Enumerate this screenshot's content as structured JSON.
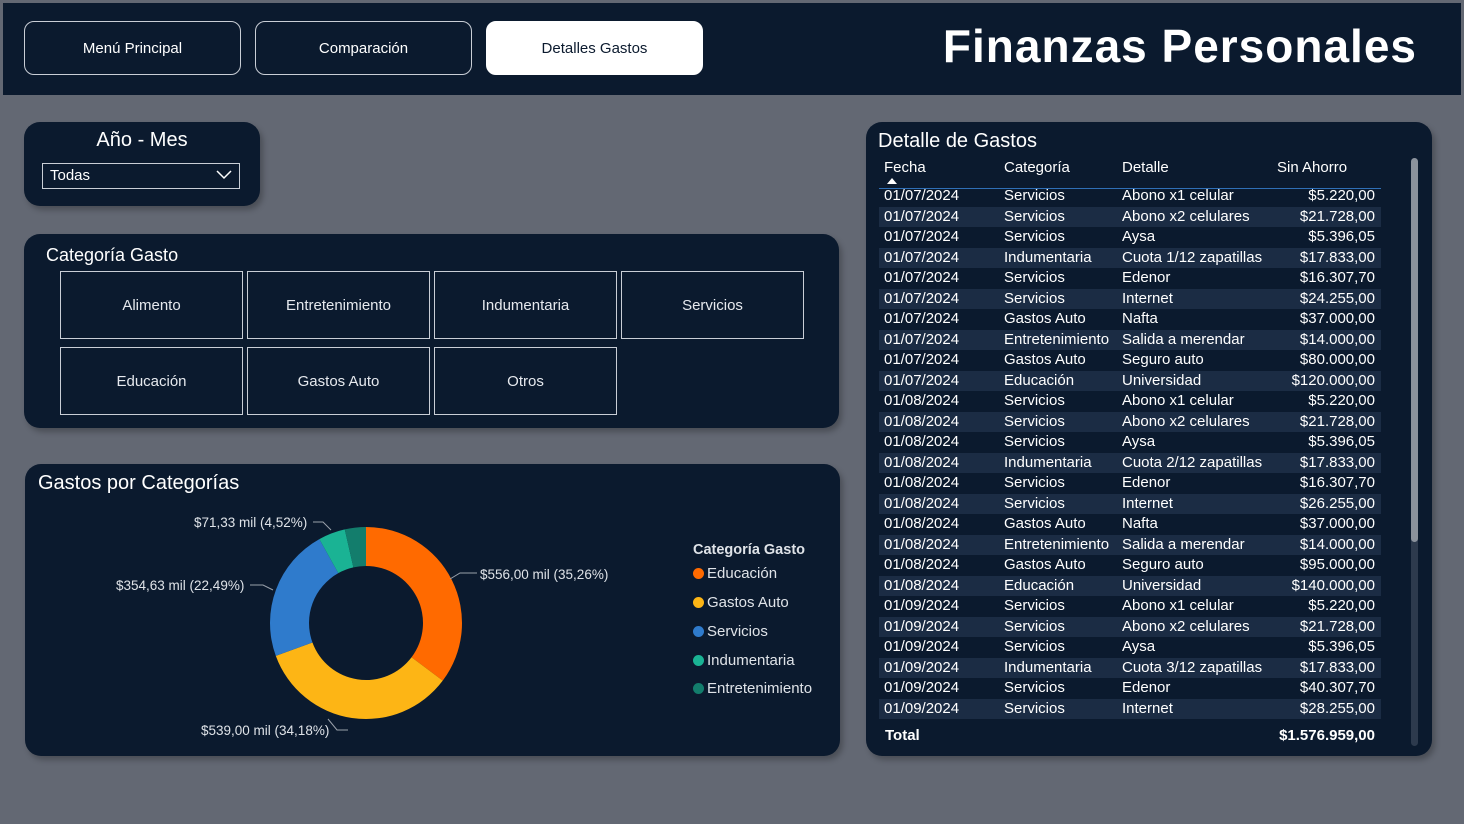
{
  "nav": {
    "buttons": [
      "Menú Principal",
      "Comparación",
      "Detalles Gastos"
    ],
    "title": "Finanzas Personales"
  },
  "filter": {
    "title": "Año - Mes",
    "selected": "Todas",
    "icon": "chevron-down-icon"
  },
  "category_slicer": {
    "title": "Categoría Gasto",
    "items": [
      "Alimento",
      "Entretenimiento",
      "Indumentaria",
      "Servicios",
      "Educación",
      "Gastos Auto",
      "Otros"
    ]
  },
  "donut": {
    "title": "Gastos por Categorías",
    "legend_title": "Categoría Gasto",
    "slice_labels": [
      "$556,00 mil (35,26%)",
      "$539,00 mil (34,18%)",
      "$354,63 mil (22,49%)",
      "$71,33 mil (4,52%)"
    ]
  },
  "chart_data": {
    "type": "pie",
    "title": "Gastos por Categorías",
    "legend_title": "Categoría Gasto",
    "legend_position": "right",
    "categories": [
      "Educación",
      "Gastos Auto",
      "Servicios",
      "Indumentaria",
      "Entretenimiento"
    ],
    "values": [
      556.0,
      539.0,
      354.63,
      71.33,
      56.0
    ],
    "percent": [
      35.26,
      34.18,
      22.49,
      4.52,
      3.55
    ],
    "colors": [
      "#ff6a00",
      "#fdb515",
      "#2f7bcc",
      "#1ab394",
      "#137d6c"
    ]
  },
  "table": {
    "title": "Detalle de Gastos",
    "columns": [
      "Fecha",
      "Categoría",
      "Detalle",
      "Sin Ahorro"
    ],
    "rows": [
      [
        "01/07/2024",
        "Servicios",
        "Abono x1 celular",
        "$5.220,00"
      ],
      [
        "01/07/2024",
        "Servicios",
        "Abono x2 celulares",
        "$21.728,00"
      ],
      [
        "01/07/2024",
        "Servicios",
        "Aysa",
        "$5.396,05"
      ],
      [
        "01/07/2024",
        "Indumentaria",
        "Cuota 1/12 zapatillas",
        "$17.833,00"
      ],
      [
        "01/07/2024",
        "Servicios",
        "Edenor",
        "$16.307,70"
      ],
      [
        "01/07/2024",
        "Servicios",
        "Internet",
        "$24.255,00"
      ],
      [
        "01/07/2024",
        "Gastos Auto",
        "Nafta",
        "$37.000,00"
      ],
      [
        "01/07/2024",
        "Entretenimiento",
        "Salida a merendar",
        "$14.000,00"
      ],
      [
        "01/07/2024",
        "Gastos Auto",
        "Seguro auto",
        "$80.000,00"
      ],
      [
        "01/07/2024",
        "Educación",
        "Universidad",
        "$120.000,00"
      ],
      [
        "01/08/2024",
        "Servicios",
        "Abono x1 celular",
        "$5.220,00"
      ],
      [
        "01/08/2024",
        "Servicios",
        "Abono x2 celulares",
        "$21.728,00"
      ],
      [
        "01/08/2024",
        "Servicios",
        "Aysa",
        "$5.396,05"
      ],
      [
        "01/08/2024",
        "Indumentaria",
        "Cuota 2/12 zapatillas",
        "$17.833,00"
      ],
      [
        "01/08/2024",
        "Servicios",
        "Edenor",
        "$16.307,70"
      ],
      [
        "01/08/2024",
        "Servicios",
        "Internet",
        "$26.255,00"
      ],
      [
        "01/08/2024",
        "Gastos Auto",
        "Nafta",
        "$37.000,00"
      ],
      [
        "01/08/2024",
        "Entretenimiento",
        "Salida a merendar",
        "$14.000,00"
      ],
      [
        "01/08/2024",
        "Gastos Auto",
        "Seguro auto",
        "$95.000,00"
      ],
      [
        "01/08/2024",
        "Educación",
        "Universidad",
        "$140.000,00"
      ],
      [
        "01/09/2024",
        "Servicios",
        "Abono x1 celular",
        "$5.220,00"
      ],
      [
        "01/09/2024",
        "Servicios",
        "Abono x2 celulares",
        "$21.728,00"
      ],
      [
        "01/09/2024",
        "Servicios",
        "Aysa",
        "$5.396,05"
      ],
      [
        "01/09/2024",
        "Indumentaria",
        "Cuota 3/12 zapatillas",
        "$17.833,00"
      ],
      [
        "01/09/2024",
        "Servicios",
        "Edenor",
        "$40.307,70"
      ],
      [
        "01/09/2024",
        "Servicios",
        "Internet",
        "$28.255,00"
      ]
    ],
    "total_label": "Total",
    "total_value": "$1.576.959,00"
  }
}
